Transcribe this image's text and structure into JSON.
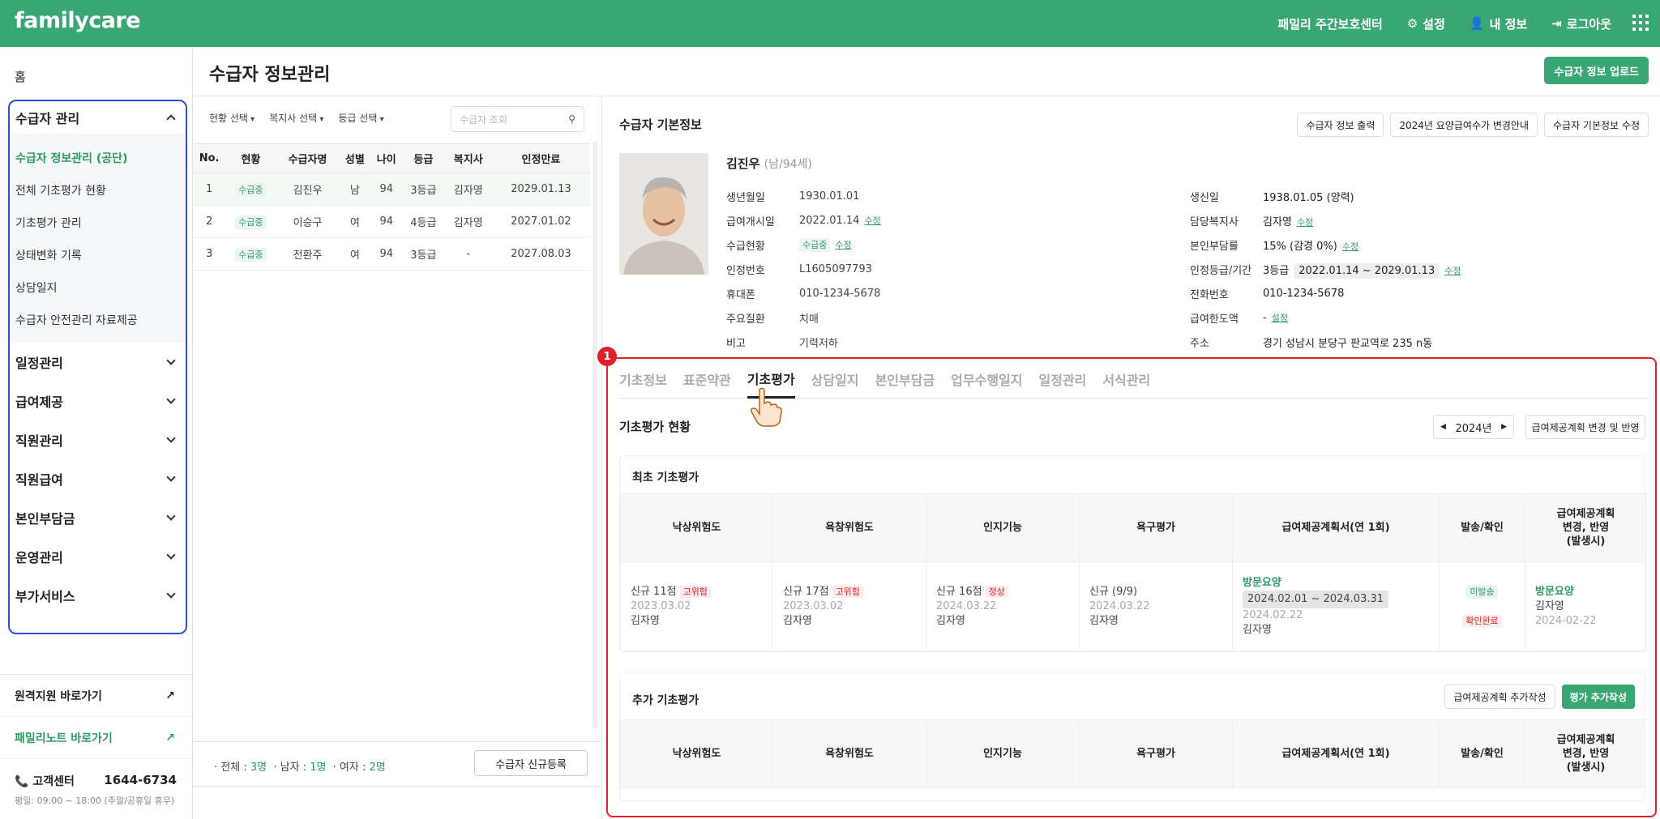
{
  "header": {
    "logo": "familycare",
    "center_name": "패밀리 주간보호센터",
    "settings": "설정",
    "my_info": "내 정보",
    "logout": "로그아웃"
  },
  "sidebar": {
    "home": "홈",
    "recipient_mgmt": "수급자 관리",
    "sub_items": [
      "수급자 정보관리 (공단)",
      "전체 기초평가 현황",
      "기초평가 관리",
      "상태변화 기록",
      "상담일지",
      "수급자 안전관리 자료제공"
    ],
    "menus": [
      "일정관리",
      "급여제공",
      "직원관리",
      "직원급여",
      "본인부담금",
      "운영관리",
      "부가서비스"
    ],
    "remote_support": "원격지원 바로가기",
    "family_note": "패밀리노트 바로가기",
    "customer_center": "고객센터",
    "phone": "1644-6734",
    "hours": "평일: 09:00 ~ 18:00 (주말/공휴일 휴무)"
  },
  "page": {
    "title": "수급자 정보관리",
    "upload_button": "수급자 정보 업로드"
  },
  "list": {
    "filters": [
      "현황 선택",
      "복지사 선택",
      "등급 선택"
    ],
    "search_placeholder": "수급자 조회",
    "columns": [
      "No.",
      "현황",
      "수급자명",
      "성별",
      "나이",
      "등급",
      "복지사",
      "인정만료"
    ],
    "rows": [
      [
        "1",
        "수급중",
        "김진우",
        "남",
        "94",
        "3등급",
        "김자영",
        "2029.01.13"
      ],
      [
        "2",
        "수급중",
        "이승구",
        "여",
        "94",
        "4등급",
        "김자영",
        "2027.01.02"
      ],
      [
        "3",
        "수급중",
        "전환주",
        "여",
        "94",
        "3등급",
        "-",
        "2027.08.03"
      ]
    ],
    "total_label": "전체 :",
    "total": "3명",
    "male_label": "남자 :",
    "male": "1명",
    "female_label": "여자 :",
    "female": "2명",
    "register_button": "수급자 신규등록"
  },
  "info": {
    "title": "수급자 기본정보",
    "buttons": [
      "수급자 정보 출력",
      "2024년 요양급여수가 변경안내",
      "수급자 기본정보 수정"
    ],
    "name": "김진우",
    "meta": "(남/94세)",
    "edit_label": "수정",
    "set_label": "설정",
    "left_fields": [
      {
        "label": "생년월일",
        "value": "1930.01.01"
      },
      {
        "label": "급여개시일",
        "value": "2022.01.14"
      },
      {
        "label": "수급현황",
        "value": "수급중"
      },
      {
        "label": "인정번호",
        "value": "L1605097793"
      },
      {
        "label": "휴대폰",
        "value": "010-1234-5678"
      },
      {
        "label": "주요질환",
        "value": "치매"
      },
      {
        "label": "비고",
        "value": "기력저하"
      }
    ],
    "right_fields": [
      {
        "label": "생신일",
        "value": "1938.01.05 (양력)"
      },
      {
        "label": "담당복지사",
        "value": "김자영"
      },
      {
        "label": "본인부담률",
        "value": "15% (감경 0%)"
      },
      {
        "label": "인정등급/기간",
        "value": "3등급",
        "period": "2022.01.14 ~ 2029.01.13"
      },
      {
        "label": "전화번호",
        "value": "010-1234-5678"
      },
      {
        "label": "급여한도액",
        "value": "-"
      },
      {
        "label": "주소",
        "value": "경기 성남시 분당구 판교역로 235 n동"
      }
    ]
  },
  "badge": "1",
  "tabs": [
    "기초정보",
    "표준약관",
    "기초평가",
    "상담일지",
    "본인부담금",
    "업무수행일지",
    "일정관리",
    "서식관리"
  ],
  "eval": {
    "title": "기초평가 현황",
    "year": "2024년",
    "plan_button": "급여제공계획 변경 및 반영",
    "initial_title": "최초 기초평가",
    "additional_title": "추가 기초평가",
    "add_plan_button": "급여제공계획 추가작성",
    "add_eval_button": "평가 추가작성",
    "columns": [
      "낙상위험도",
      "욕창위험도",
      "인지기능",
      "욕구평가",
      "급여제공계획서(연 1회)",
      "발송/확인",
      "급여제공계획\n변경, 반영\n(발생시)"
    ],
    "row": {
      "fall": {
        "score": "신규 11점",
        "tag": "고위험",
        "date": "2023.03.02",
        "by": "김자영"
      },
      "sore": {
        "score": "신규 17점",
        "tag": "고위험",
        "date": "2023.03.02",
        "by": "김자영"
      },
      "cog": {
        "score": "신규 16점",
        "tag": "정상",
        "date": "2024.03.22",
        "by": "김자영"
      },
      "needs": {
        "score": "신규 (9/9)",
        "date": "2024.03.22",
        "by": "김자영"
      },
      "plan": {
        "type": "방문요양",
        "period": "2024.02.01 ~ 2024.03.31",
        "date": "2024.02.22",
        "by": "김자영"
      },
      "send": {
        "unsent": "미발송",
        "confirmed": "확인완료"
      },
      "change": {
        "type": "방문요양",
        "by": "김자영",
        "date": "2024-02-22"
      }
    }
  }
}
